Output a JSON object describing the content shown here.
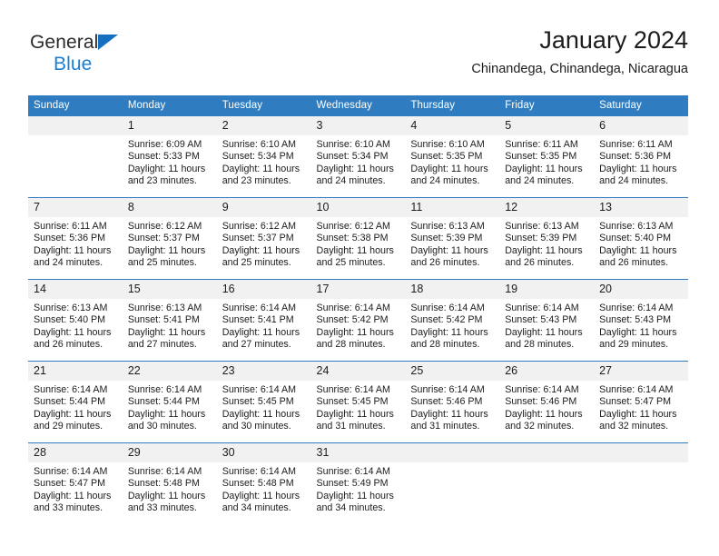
{
  "logo": {
    "name_top": "General",
    "name_bottom": "Blue",
    "triangle_color": "#1570bf",
    "blue_color": "#1a7fd4"
  },
  "header": {
    "title": "January 2024",
    "subtitle": "Chinandega, Chinandega, Nicaragua"
  },
  "theme": {
    "header_blue": "#2f7dc0",
    "daynum_band": "#f1f1f1",
    "text": "#1c1c1c"
  },
  "calendar": {
    "weekday_headers": [
      "Sunday",
      "Monday",
      "Tuesday",
      "Wednesday",
      "Thursday",
      "Friday",
      "Saturday"
    ],
    "labels": {
      "sunrise": "Sunrise:",
      "sunset": "Sunset:",
      "daylight": "Daylight:"
    },
    "weeks": [
      [
        {
          "day": "",
          "sunrise": "",
          "sunset": "",
          "daylight_line1": "",
          "daylight_line2": "",
          "empty": true
        },
        {
          "day": "1",
          "sunrise": "Sunrise: 6:09 AM",
          "sunset": "Sunset: 5:33 PM",
          "daylight_line1": "Daylight: 11 hours",
          "daylight_line2": "and 23 minutes."
        },
        {
          "day": "2",
          "sunrise": "Sunrise: 6:10 AM",
          "sunset": "Sunset: 5:34 PM",
          "daylight_line1": "Daylight: 11 hours",
          "daylight_line2": "and 23 minutes."
        },
        {
          "day": "3",
          "sunrise": "Sunrise: 6:10 AM",
          "sunset": "Sunset: 5:34 PM",
          "daylight_line1": "Daylight: 11 hours",
          "daylight_line2": "and 24 minutes."
        },
        {
          "day": "4",
          "sunrise": "Sunrise: 6:10 AM",
          "sunset": "Sunset: 5:35 PM",
          "daylight_line1": "Daylight: 11 hours",
          "daylight_line2": "and 24 minutes."
        },
        {
          "day": "5",
          "sunrise": "Sunrise: 6:11 AM",
          "sunset": "Sunset: 5:35 PM",
          "daylight_line1": "Daylight: 11 hours",
          "daylight_line2": "and 24 minutes."
        },
        {
          "day": "6",
          "sunrise": "Sunrise: 6:11 AM",
          "sunset": "Sunset: 5:36 PM",
          "daylight_line1": "Daylight: 11 hours",
          "daylight_line2": "and 24 minutes."
        }
      ],
      [
        {
          "day": "7",
          "sunrise": "Sunrise: 6:11 AM",
          "sunset": "Sunset: 5:36 PM",
          "daylight_line1": "Daylight: 11 hours",
          "daylight_line2": "and 24 minutes."
        },
        {
          "day": "8",
          "sunrise": "Sunrise: 6:12 AM",
          "sunset": "Sunset: 5:37 PM",
          "daylight_line1": "Daylight: 11 hours",
          "daylight_line2": "and 25 minutes."
        },
        {
          "day": "9",
          "sunrise": "Sunrise: 6:12 AM",
          "sunset": "Sunset: 5:37 PM",
          "daylight_line1": "Daylight: 11 hours",
          "daylight_line2": "and 25 minutes."
        },
        {
          "day": "10",
          "sunrise": "Sunrise: 6:12 AM",
          "sunset": "Sunset: 5:38 PM",
          "daylight_line1": "Daylight: 11 hours",
          "daylight_line2": "and 25 minutes."
        },
        {
          "day": "11",
          "sunrise": "Sunrise: 6:13 AM",
          "sunset": "Sunset: 5:39 PM",
          "daylight_line1": "Daylight: 11 hours",
          "daylight_line2": "and 26 minutes."
        },
        {
          "day": "12",
          "sunrise": "Sunrise: 6:13 AM",
          "sunset": "Sunset: 5:39 PM",
          "daylight_line1": "Daylight: 11 hours",
          "daylight_line2": "and 26 minutes."
        },
        {
          "day": "13",
          "sunrise": "Sunrise: 6:13 AM",
          "sunset": "Sunset: 5:40 PM",
          "daylight_line1": "Daylight: 11 hours",
          "daylight_line2": "and 26 minutes."
        }
      ],
      [
        {
          "day": "14",
          "sunrise": "Sunrise: 6:13 AM",
          "sunset": "Sunset: 5:40 PM",
          "daylight_line1": "Daylight: 11 hours",
          "daylight_line2": "and 26 minutes."
        },
        {
          "day": "15",
          "sunrise": "Sunrise: 6:13 AM",
          "sunset": "Sunset: 5:41 PM",
          "daylight_line1": "Daylight: 11 hours",
          "daylight_line2": "and 27 minutes."
        },
        {
          "day": "16",
          "sunrise": "Sunrise: 6:14 AM",
          "sunset": "Sunset: 5:41 PM",
          "daylight_line1": "Daylight: 11 hours",
          "daylight_line2": "and 27 minutes."
        },
        {
          "day": "17",
          "sunrise": "Sunrise: 6:14 AM",
          "sunset": "Sunset: 5:42 PM",
          "daylight_line1": "Daylight: 11 hours",
          "daylight_line2": "and 28 minutes."
        },
        {
          "day": "18",
          "sunrise": "Sunrise: 6:14 AM",
          "sunset": "Sunset: 5:42 PM",
          "daylight_line1": "Daylight: 11 hours",
          "daylight_line2": "and 28 minutes."
        },
        {
          "day": "19",
          "sunrise": "Sunrise: 6:14 AM",
          "sunset": "Sunset: 5:43 PM",
          "daylight_line1": "Daylight: 11 hours",
          "daylight_line2": "and 28 minutes."
        },
        {
          "day": "20",
          "sunrise": "Sunrise: 6:14 AM",
          "sunset": "Sunset: 5:43 PM",
          "daylight_line1": "Daylight: 11 hours",
          "daylight_line2": "and 29 minutes."
        }
      ],
      [
        {
          "day": "21",
          "sunrise": "Sunrise: 6:14 AM",
          "sunset": "Sunset: 5:44 PM",
          "daylight_line1": "Daylight: 11 hours",
          "daylight_line2": "and 29 minutes."
        },
        {
          "day": "22",
          "sunrise": "Sunrise: 6:14 AM",
          "sunset": "Sunset: 5:44 PM",
          "daylight_line1": "Daylight: 11 hours",
          "daylight_line2": "and 30 minutes."
        },
        {
          "day": "23",
          "sunrise": "Sunrise: 6:14 AM",
          "sunset": "Sunset: 5:45 PM",
          "daylight_line1": "Daylight: 11 hours",
          "daylight_line2": "and 30 minutes."
        },
        {
          "day": "24",
          "sunrise": "Sunrise: 6:14 AM",
          "sunset": "Sunset: 5:45 PM",
          "daylight_line1": "Daylight: 11 hours",
          "daylight_line2": "and 31 minutes."
        },
        {
          "day": "25",
          "sunrise": "Sunrise: 6:14 AM",
          "sunset": "Sunset: 5:46 PM",
          "daylight_line1": "Daylight: 11 hours",
          "daylight_line2": "and 31 minutes."
        },
        {
          "day": "26",
          "sunrise": "Sunrise: 6:14 AM",
          "sunset": "Sunset: 5:46 PM",
          "daylight_line1": "Daylight: 11 hours",
          "daylight_line2": "and 32 minutes."
        },
        {
          "day": "27",
          "sunrise": "Sunrise: 6:14 AM",
          "sunset": "Sunset: 5:47 PM",
          "daylight_line1": "Daylight: 11 hours",
          "daylight_line2": "and 32 minutes."
        }
      ],
      [
        {
          "day": "28",
          "sunrise": "Sunrise: 6:14 AM",
          "sunset": "Sunset: 5:47 PM",
          "daylight_line1": "Daylight: 11 hours",
          "daylight_line2": "and 33 minutes."
        },
        {
          "day": "29",
          "sunrise": "Sunrise: 6:14 AM",
          "sunset": "Sunset: 5:48 PM",
          "daylight_line1": "Daylight: 11 hours",
          "daylight_line2": "and 33 minutes."
        },
        {
          "day": "30",
          "sunrise": "Sunrise: 6:14 AM",
          "sunset": "Sunset: 5:48 PM",
          "daylight_line1": "Daylight: 11 hours",
          "daylight_line2": "and 34 minutes."
        },
        {
          "day": "31",
          "sunrise": "Sunrise: 6:14 AM",
          "sunset": "Sunset: 5:49 PM",
          "daylight_line1": "Daylight: 11 hours",
          "daylight_line2": "and 34 minutes."
        },
        {
          "day": "",
          "sunrise": "",
          "sunset": "",
          "daylight_line1": "",
          "daylight_line2": "",
          "empty": true
        },
        {
          "day": "",
          "sunrise": "",
          "sunset": "",
          "daylight_line1": "",
          "daylight_line2": "",
          "empty": true
        },
        {
          "day": "",
          "sunrise": "",
          "sunset": "",
          "daylight_line1": "",
          "daylight_line2": "",
          "empty": true
        }
      ]
    ]
  }
}
